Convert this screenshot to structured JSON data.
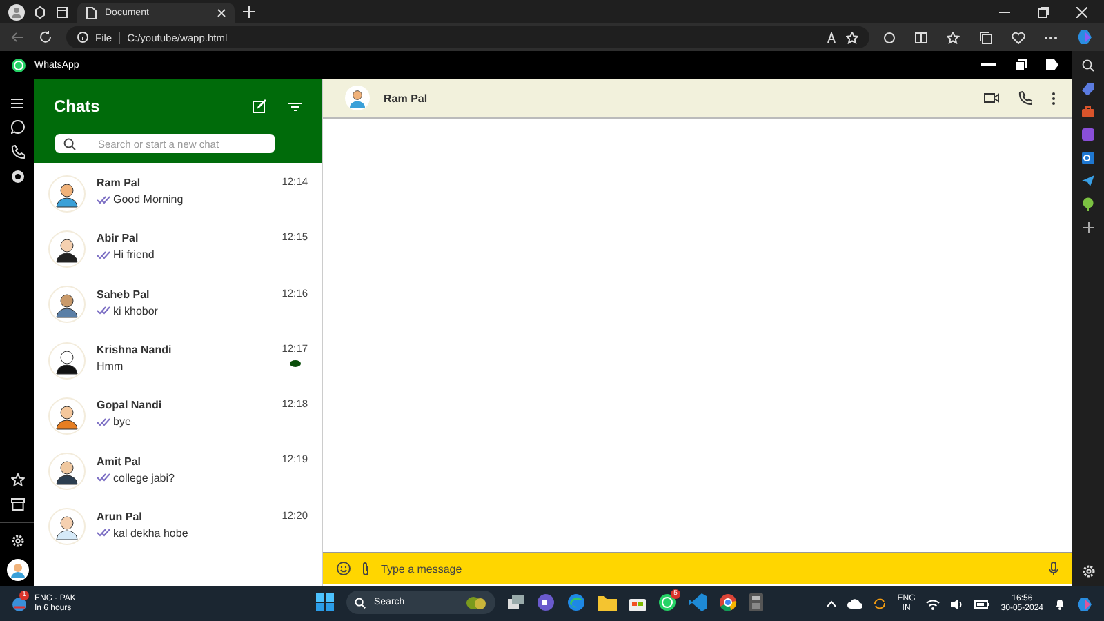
{
  "browser": {
    "tabs": [
      {
        "title": "Document",
        "selected": true
      }
    ],
    "address": {
      "scheme": "File",
      "url": "C:/youtube/wapp.html"
    }
  },
  "app": {
    "title": "WhatsApp"
  },
  "chats_panel": {
    "title": "Chats",
    "search": {
      "placeholder": "Search or start a new chat"
    },
    "chats": [
      {
        "name": "Ram Pal",
        "message": "Good Morning",
        "time": "12:14",
        "ticks": true,
        "unread": false
      },
      {
        "name": "Abir Pal",
        "message": "Hi friend",
        "time": "12:15",
        "ticks": true,
        "unread": false
      },
      {
        "name": "Saheb Pal",
        "message": "ki khobor",
        "time": "12:16",
        "ticks": true,
        "unread": false
      },
      {
        "name": "Krishna Nandi",
        "message": "Hmm",
        "time": "12:17",
        "ticks": false,
        "unread": true
      },
      {
        "name": "Gopal Nandi",
        "message": "bye",
        "time": "12:18",
        "ticks": true,
        "unread": false
      },
      {
        "name": "Amit Pal",
        "message": "college jabi?",
        "time": "12:19",
        "ticks": true,
        "unread": false
      },
      {
        "name": "Arun Pal",
        "message": "kal dekha hobe",
        "time": "12:20",
        "ticks": true,
        "unread": false
      }
    ]
  },
  "conversation": {
    "contact": "Ram Pal",
    "composer": {
      "placeholder": "Type a message"
    }
  },
  "taskbar": {
    "weather": {
      "title": "ENG - PAK",
      "subtitle": "In 6 hours",
      "badge": "1"
    },
    "search": "Search",
    "whatsapp_badge": "5",
    "language": {
      "top": "ENG",
      "bottom": "IN"
    },
    "clock": {
      "time": "16:56",
      "date": "30-05-2024"
    }
  }
}
